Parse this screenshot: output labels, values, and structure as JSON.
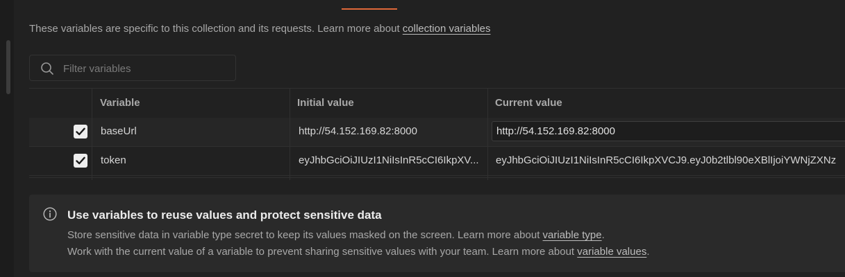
{
  "description": {
    "text": "These variables are specific to this collection and its requests. Learn more about ",
    "link": "collection variables"
  },
  "filter": {
    "placeholder": "Filter variables"
  },
  "table": {
    "headers": {
      "variable": "Variable",
      "initial_value": "Initial value",
      "current_value": "Current value"
    },
    "rows": [
      {
        "enabled": true,
        "variable": "baseUrl",
        "initial_value": "http://54.152.169.82:8000",
        "current_value": "http://54.152.169.82:8000"
      },
      {
        "enabled": true,
        "variable": "token",
        "initial_value": "eyJhbGciOiJIUzI1NiIsInR5cCI6IkpXV...",
        "current_value": "eyJhbGciOiJIUzI1NiIsInR5cCI6IkpXVCJ9.eyJ0b2tlbl90eXBlIjoiYWNjZXNz"
      }
    ]
  },
  "info": {
    "title": "Use variables to reuse values and protect sensitive data",
    "line1_text": "Store sensitive data in variable type secret to keep its values masked on the screen. Learn more about ",
    "line1_link": "variable type",
    "line1_end": ".",
    "line2_text": "Work with the current value of a variable to prevent sharing sensitive values with your team. Learn more about ",
    "line2_link": "variable values",
    "line2_end": "."
  },
  "colors": {
    "accent": "#e0683a",
    "background": "#212121",
    "checkbox": "#eeeeee"
  },
  "icons": {
    "search": "search-icon",
    "info": "info-icon",
    "check": "checkmark-icon"
  }
}
